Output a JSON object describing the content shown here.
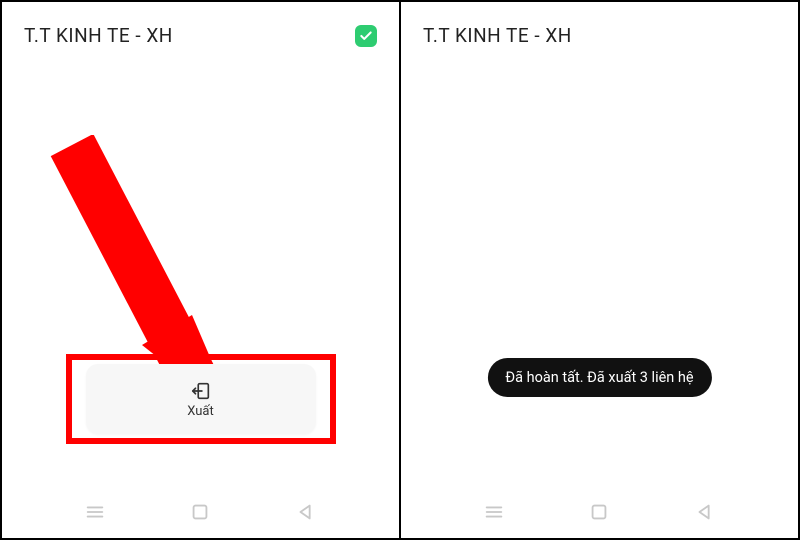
{
  "left": {
    "title": "T.T KINH TE - XH",
    "exportLabel": "Xuất",
    "checkbox": {
      "checked": true
    }
  },
  "right": {
    "title": "T.T KINH TE - XH",
    "toast": "Đã hoàn tất. Đã xuất 3 liên hệ"
  },
  "colors": {
    "highlight": "#ff0000",
    "accent": "#2ecc71"
  },
  "icons": {
    "export": "export-icon",
    "menu": "menu-icon",
    "home": "home-square-icon",
    "back": "back-triangle-icon",
    "check": "check-icon"
  }
}
